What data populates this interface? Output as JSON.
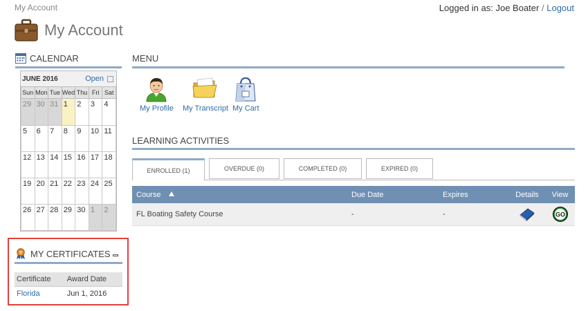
{
  "header": {
    "breadcrumb": "My Account",
    "logged_in_prefix": "Logged in as: Joe Boater",
    "separator": "/",
    "logout_label": "Logout",
    "page_title": "My Account"
  },
  "calendar": {
    "section_title": "CALENDAR",
    "month_label": "JUNE 2016",
    "open_label": "Open",
    "weekdays": [
      "Sun",
      "Mon",
      "Tue",
      "Wed",
      "Thu",
      "Fri",
      "Sat"
    ],
    "weeks": [
      [
        "29",
        "30",
        "31",
        "1",
        "2",
        "3",
        "4"
      ],
      [
        "5",
        "6",
        "7",
        "8",
        "9",
        "10",
        "11"
      ],
      [
        "12",
        "13",
        "14",
        "15",
        "16",
        "17",
        "18"
      ],
      [
        "19",
        "20",
        "21",
        "22",
        "23",
        "24",
        "25"
      ],
      [
        "26",
        "27",
        "28",
        "29",
        "30",
        "1",
        "2"
      ]
    ]
  },
  "certificates": {
    "section_title": "MY CERTIFICATES",
    "col_certificate": "Certificate",
    "col_award_date": "Award Date",
    "rows": [
      {
        "certificate": "Florida",
        "award_date": "Jun 1, 2016"
      }
    ]
  },
  "menu": {
    "section_title": "MENU",
    "items": [
      {
        "label": "My Profile"
      },
      {
        "label": "My Transcript"
      },
      {
        "label": "My Cart"
      }
    ]
  },
  "learning": {
    "section_title": "LEARNING ACTIVITIES",
    "tabs": [
      {
        "label": "ENROLLED (1)"
      },
      {
        "label": "OVERDUE (0)"
      },
      {
        "label": "COMPLETED (0)"
      },
      {
        "label": "EXPIRED (0)"
      }
    ],
    "columns": {
      "course": "Course",
      "due_date": "Due Date",
      "expires": "Expires",
      "details": "Details",
      "view": "View"
    },
    "rows": [
      {
        "course": "FL Boating Safety Course",
        "due_date": "-",
        "expires": "-"
      }
    ],
    "go_label": "GO"
  }
}
